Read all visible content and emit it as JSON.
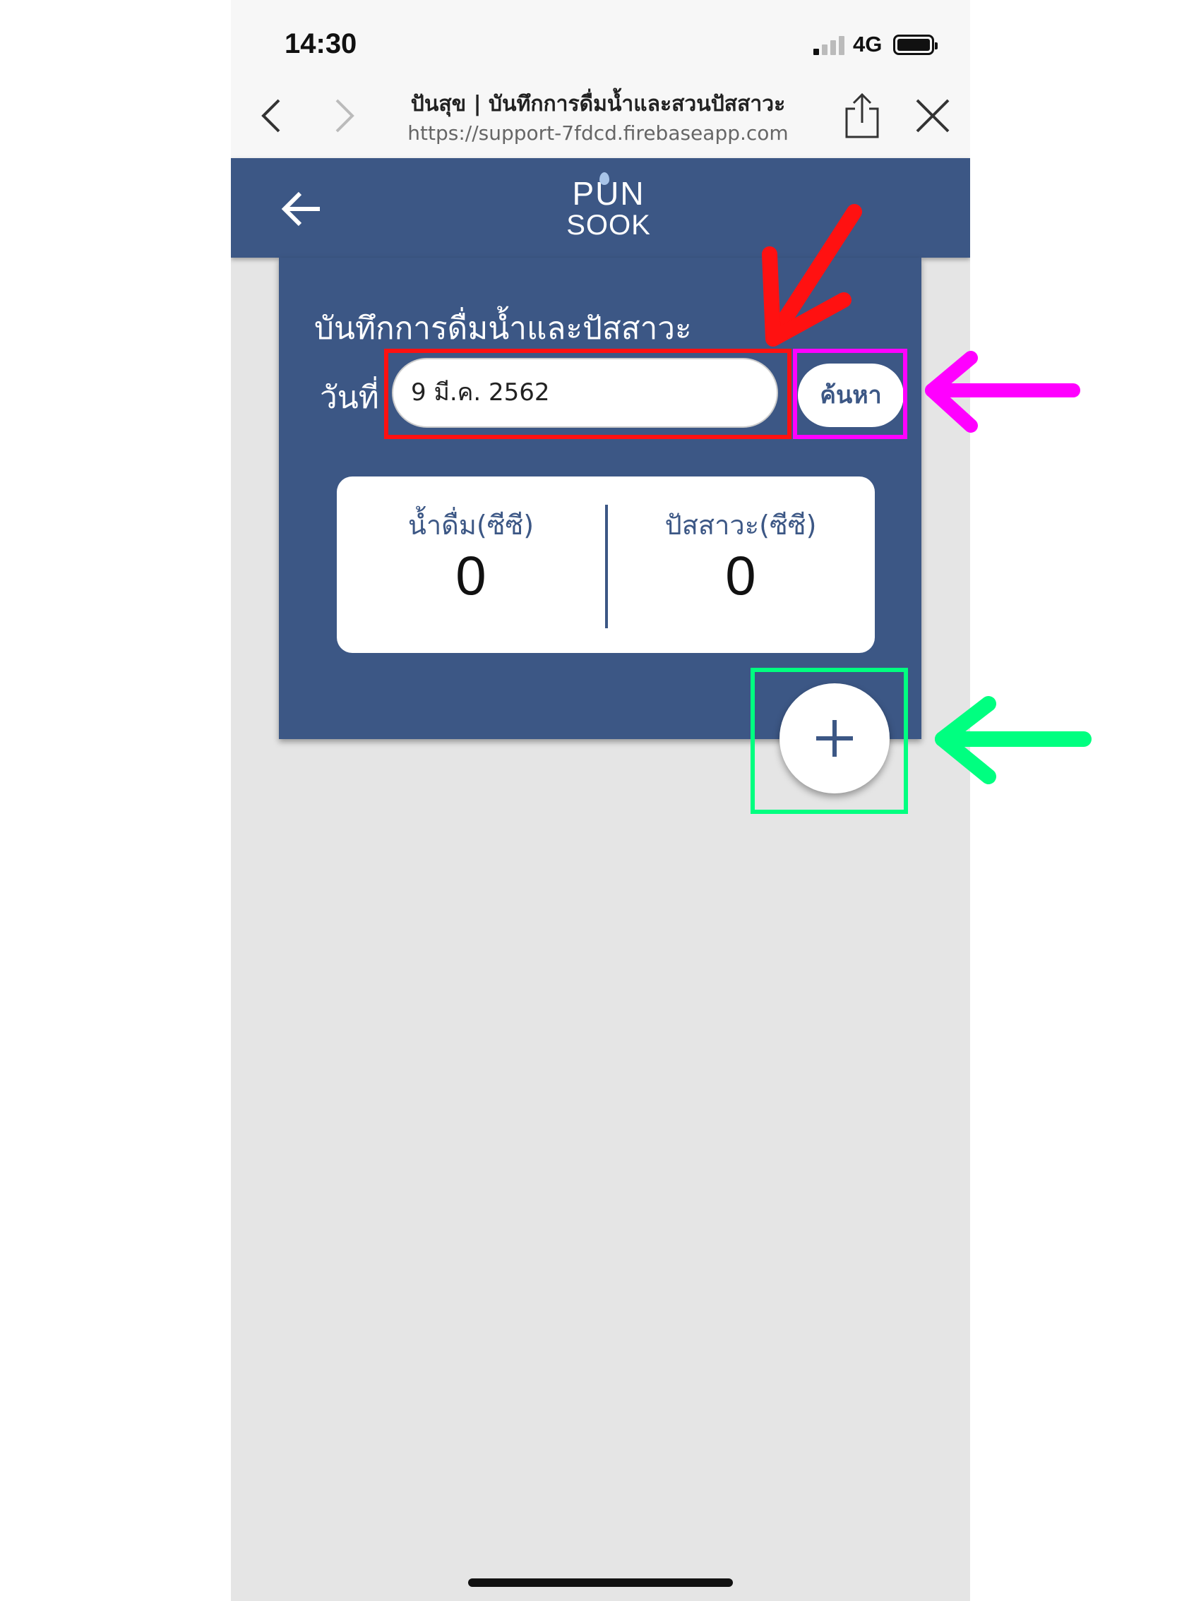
{
  "status_bar": {
    "time": "14:30",
    "network": "4G",
    "signal_bars_active": 1,
    "signal_bars_total": 4
  },
  "browser": {
    "page_title": "ปันสุข | บันทึกการดื่มน้ำและสวนปัสสาวะ",
    "url": "https://support-7fdcd.firebaseapp.com",
    "icons": [
      "chevron-left-icon",
      "chevron-right-icon",
      "share-icon",
      "close-icon"
    ]
  },
  "app_header": {
    "back_icon": "arrow-left-icon",
    "logo_line1": "PUN",
    "logo_line2": "SOOK"
  },
  "record": {
    "title": "บันทึกการดื่มน้ำและปัสสาวะ",
    "date_label": "วันที่",
    "date_value": "9 มี.ค. 2562",
    "search_label": "ค้นหา",
    "water_label": "น้ำดื่ม(ซีซี)",
    "water_value": "0",
    "urine_label": "ปัสสาวะ(ซีซี)",
    "urine_value": "0",
    "add_icon": "plus-icon"
  },
  "colors": {
    "primary": "#3c5785",
    "background": "#e5e5e5",
    "annotation_red": "#ff1111",
    "annotation_magenta": "#ff00ff",
    "annotation_green": "#00ff80"
  }
}
